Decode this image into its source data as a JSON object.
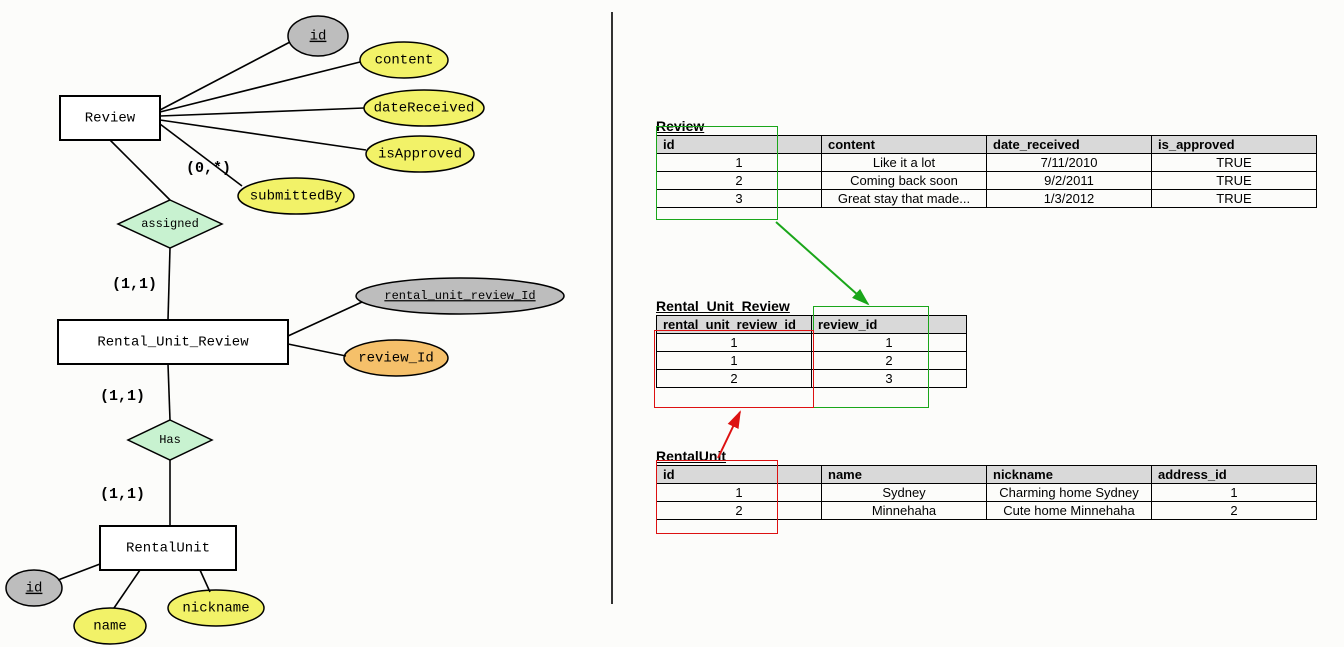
{
  "er": {
    "entities": {
      "review": "Review",
      "rur": "Rental_Unit_Review",
      "rental_unit": "RentalUnit"
    },
    "attributes": {
      "id_review": "id",
      "content": "content",
      "dateReceived": "dateReceived",
      "isApproved": "isApproved",
      "submittedBy": "submittedBy",
      "rur_id": "rental_unit_review_Id",
      "review_id": "review_Id",
      "id_ru": "id",
      "name": "name",
      "nickname": "nickname"
    },
    "relationships": {
      "assigned": "assigned",
      "has": "Has"
    },
    "cardinalities": {
      "review_assigned": "(0,*)",
      "assigned_rur": "(1,1)",
      "rur_has": "(1,1)",
      "has_rental": "(1,1)"
    }
  },
  "tables": {
    "review": {
      "title": "Review",
      "headers": [
        "id",
        "content",
        "date_received",
        "is_approved"
      ],
      "widths": [
        165,
        165,
        165,
        165
      ],
      "rows": [
        [
          "1",
          "Like it a lot",
          "7/11/2010",
          "TRUE"
        ],
        [
          "2",
          "Coming back soon",
          "9/2/2011",
          "TRUE"
        ],
        [
          "3",
          "Great stay that made...",
          "1/3/2012",
          "TRUE"
        ]
      ]
    },
    "rur": {
      "title": "Rental_Unit_Review",
      "headers": [
        "rental_unit_review_id",
        "review_id"
      ],
      "widths": [
        155,
        155
      ],
      "rows": [
        [
          "1",
          "1"
        ],
        [
          "1",
          "2"
        ],
        [
          "2",
          "3"
        ]
      ]
    },
    "rental_unit": {
      "title": "RentalUnit",
      "headers": [
        "id",
        "name",
        "nickname",
        "address_id"
      ],
      "widths": [
        165,
        165,
        165,
        165
      ],
      "rows": [
        [
          "1",
          "Sydney",
          "Charming home Sydney",
          "1"
        ],
        [
          "2",
          "Minnehaha",
          "Cute home Minnehaha",
          "2"
        ]
      ]
    }
  }
}
